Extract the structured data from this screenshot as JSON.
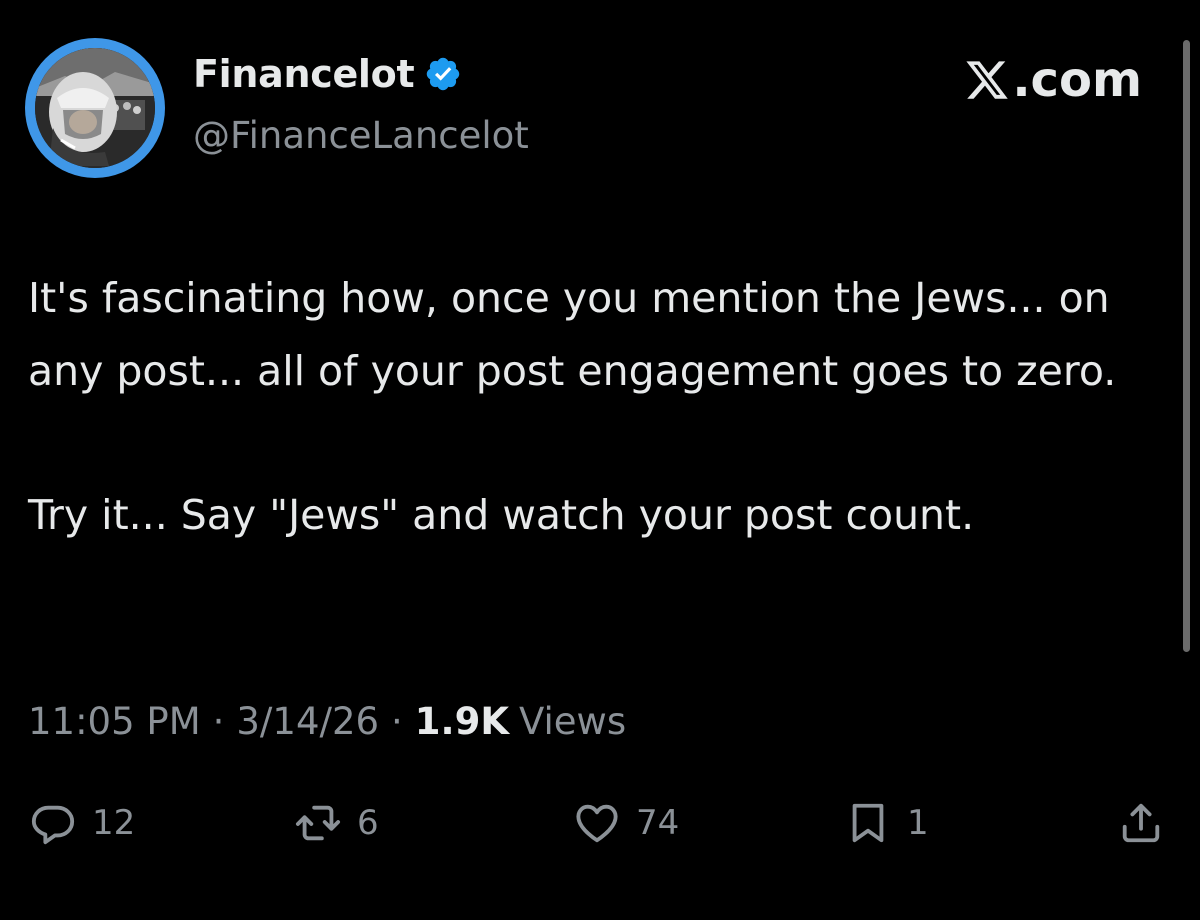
{
  "author": {
    "display_name": "Financelot",
    "handle": "@FinanceLancelot",
    "verified_icon": "verified-badge-icon",
    "avatar_ring_color": "#3f97e8"
  },
  "brand": {
    "label": ".com",
    "icon": "x-logo-icon"
  },
  "post": {
    "paragraphs": [
      "It's fascinating how, once you mention the Jews... on any post... all of your post engagement goes to zero.",
      "Try it... Say \"Jews\" and watch your post count."
    ]
  },
  "meta": {
    "time": "11:05 PM",
    "separator": "·",
    "date": "3/14/26",
    "views_count": "1.9K",
    "views_label": "Views"
  },
  "actions": {
    "reply": {
      "icon": "reply-icon",
      "count": "12"
    },
    "repost": {
      "icon": "repost-icon",
      "count": "6"
    },
    "like": {
      "icon": "heart-icon",
      "count": "74"
    },
    "bookmark": {
      "icon": "bookmark-icon",
      "count": "1"
    },
    "share": {
      "icon": "share-icon"
    }
  },
  "colors": {
    "background": "#000000",
    "primary_text": "#e7e9ea",
    "secondary_text": "#8b9197",
    "verified_blue": "#1d9bf0"
  }
}
